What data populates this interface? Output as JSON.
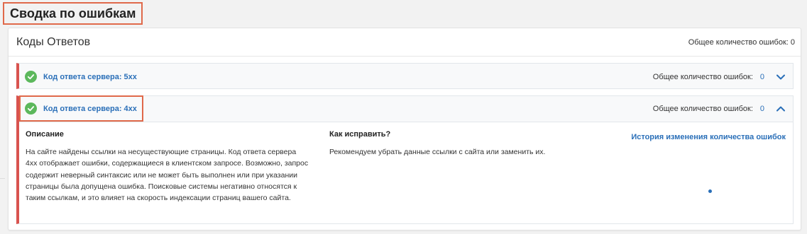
{
  "page": {
    "title": "Сводка по ошибкам"
  },
  "panel": {
    "title": "Коды Ответов",
    "total_label": "Общее количество ошибок:",
    "total_value": "0"
  },
  "items": [
    {
      "title": "Код ответа сервера: 5xx",
      "total_label": "Общее количество ошибок:",
      "total_value": "0",
      "expanded": false
    },
    {
      "title": "Код ответа сервера: 4xx",
      "total_label": "Общее количество ошибок:",
      "total_value": "0",
      "expanded": true,
      "description_heading": "Описание",
      "description_text": "На сайте найдены ссылки на несуществующие страницы. Код ответа сервера 4xx отображает ошибки, содержащиеся в клиентском запросе. Возможно, запрос содержит неверный синтаксис или не может быть выполнен или при указании страницы была допущена ошибка. Поисковые системы негативно относятся к таким ссылкам, и это влияет на скорость индексации страниц вашего сайта.",
      "fix_heading": "Как исправить?",
      "fix_text": "Рекомендуем убрать данные ссылки с сайта или заменить их.",
      "history_link": "История изменения количества ошибок"
    }
  ],
  "colors": {
    "accent_link": "#2a6fb8",
    "error_border": "#d9534f",
    "success_icon": "#5cb85c",
    "highlight_box": "#e0694a"
  },
  "icons": {
    "status": "check-circle-icon",
    "collapsed": "chevron-down-icon",
    "expanded": "chevron-up-icon"
  }
}
